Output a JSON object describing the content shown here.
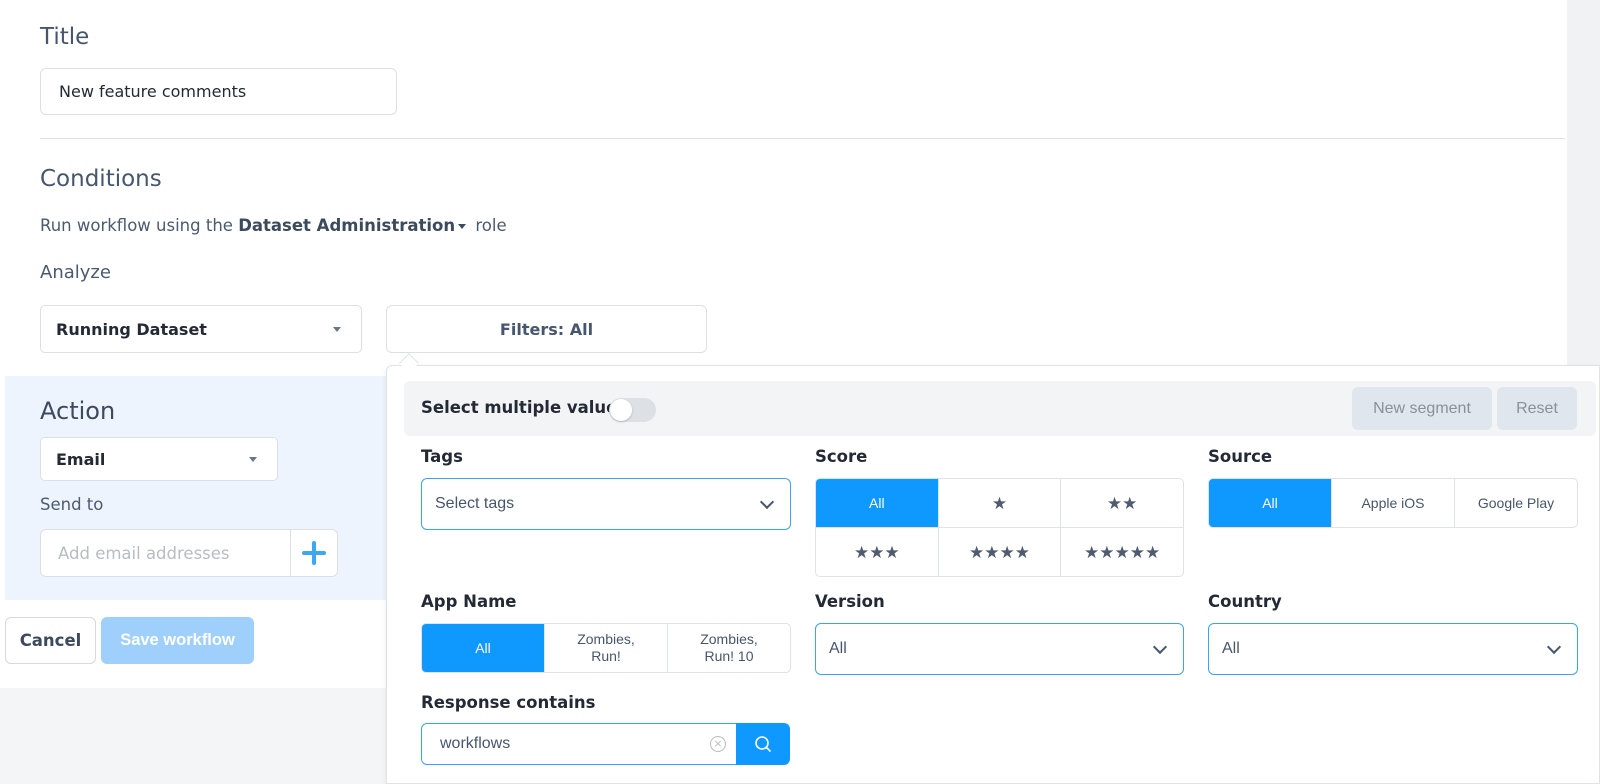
{
  "title_section": {
    "heading": "Title",
    "title_value": "New feature comments"
  },
  "conditions": {
    "heading": "Conditions",
    "role_prefix": "Run workflow using the",
    "role_name": "Dataset Administration",
    "role_suffix": "role",
    "analyze_label": "Analyze",
    "dataset_select": "Running Dataset",
    "filters_button": "Filters: All"
  },
  "action": {
    "heading": "Action",
    "action_select": "Email",
    "send_to_label": "Send to",
    "email_placeholder": "Add email addresses",
    "add_icon": "plus-icon"
  },
  "footer": {
    "cancel_label": "Cancel",
    "save_label": "Save workflow"
  },
  "filters": {
    "multi_label": "Select multiple values",
    "multi_enabled": false,
    "new_segment_label": "New segment",
    "reset_label": "Reset",
    "tags": {
      "label": "Tags",
      "placeholder": "Select tags"
    },
    "score": {
      "label": "Score",
      "options": [
        "All",
        "★",
        "★★",
        "★★★",
        "★★★★",
        "★★★★★"
      ],
      "selected": "All"
    },
    "source": {
      "label": "Source",
      "options": [
        "All",
        "Apple iOS",
        "Google Play"
      ],
      "selected": "All"
    },
    "app_name": {
      "label": "App Name",
      "options": [
        "All",
        "Zombies, Run!",
        "Zombies, Run! 10"
      ],
      "selected": "All"
    },
    "version": {
      "label": "Version",
      "value": "All"
    },
    "country": {
      "label": "Country",
      "value": "All"
    },
    "response": {
      "label": "Response contains",
      "value": "workflows"
    }
  },
  "colors": {
    "accent": "#0f98fd",
    "save_disabled": "#9fd0fb",
    "action_panel": "#eef4fd"
  }
}
